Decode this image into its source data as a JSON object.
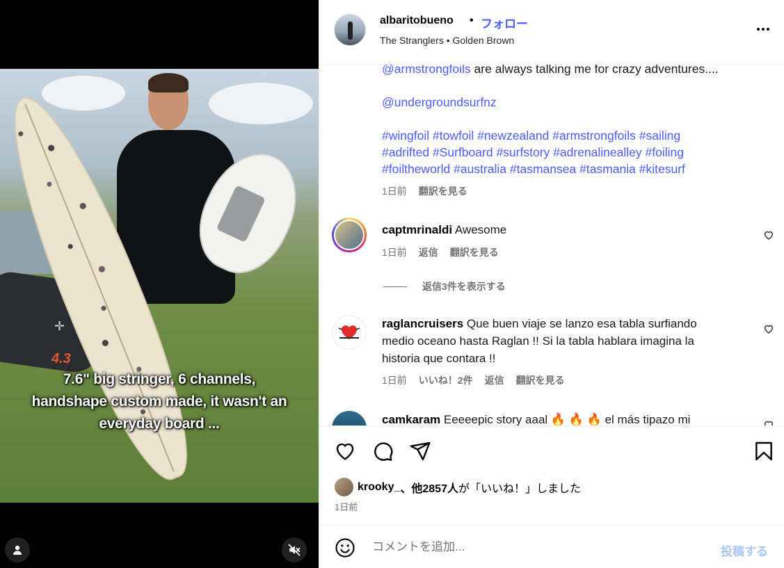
{
  "media": {
    "caption_lines": [
      "7.6\" big stringer, 6 channels,",
      "handshape custom made, it wasn't an",
      "everyday board ..."
    ],
    "kite_mark": "✛",
    "kite_label": "4.3",
    "user_button_icon": "person-icon",
    "mute_button_icon": "speaker-muted-icon"
  },
  "header": {
    "username": "albaritobueno",
    "separator": "•",
    "follow_label": "フォロー",
    "song": "The Stranglers • Golden Brown",
    "more_icon": "more-horizontal-icon"
  },
  "caption": {
    "line1_mention": "@armstrongfoils",
    "line1_text": " are always talking me for crazy adventures....",
    "mention2": "@undergroundsurfnz",
    "hashtags": [
      [
        "#wingfoil",
        "#towfoil",
        "#newzealand",
        "#armstrongfoils",
        "#sailing"
      ],
      [
        "#adrifted",
        "#Surfboard",
        "#surfstory",
        "#adrenalinealley",
        "#foiling"
      ],
      [
        "#foiltheworld",
        "#australia",
        "#tasmansea",
        "#tasmania",
        "#kitesurf"
      ]
    ],
    "time": "1日前",
    "translate": "翻訳を見る"
  },
  "comments": [
    {
      "user": "captmrinaldi",
      "text": "Awesome",
      "time": "1日前",
      "reply": "返信",
      "translate": "翻訳を見る",
      "view_replies": "返信3件を表示する"
    },
    {
      "user": "raglancruisers",
      "text": "Que buen viaje se lanzo esa tabla surfiando medio oceano hasta Raglan !! Si la tabla hablara imagina la historia que contara !!",
      "time": "1日前",
      "likes": "いいね！2件",
      "reply": "返信",
      "translate": "翻訳を見る"
    },
    {
      "user": "camkaram",
      "text": "Eeeeepic story aaal 🔥 🔥 🔥  el más tipazo mi"
    }
  ],
  "actions": {
    "like_icon": "heart-icon",
    "comment_icon": "comment-icon",
    "share_icon": "send-icon",
    "save_icon": "bookmark-icon",
    "liked_by_user": "krooky_",
    "liked_by_rest": "、他2857人",
    "liked_by_suffix": "が「いいね！」しました",
    "post_time": "1日前"
  },
  "comment_box": {
    "placeholder": "コメントを追加...",
    "post_label": "投稿する",
    "emoji_icon": "smiley-icon"
  },
  "colors": {
    "link": "#4a5df9",
    "secondary_text": "#737373",
    "post_button_disabled": "#a9c7f7",
    "story_ring": "#d62976"
  }
}
